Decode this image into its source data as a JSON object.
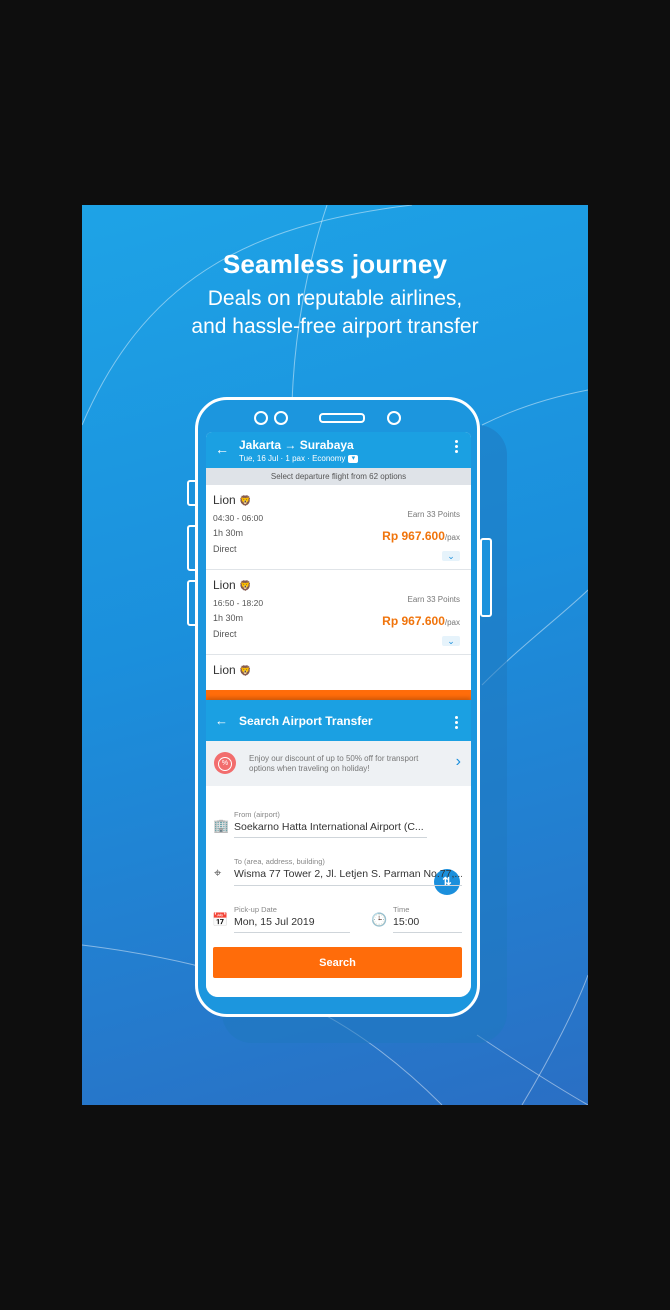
{
  "promo": {
    "headline": "Seamless journey",
    "sub_line_1": "Deals on reputable airlines,",
    "sub_line_2": "and hassle-free airport transfer"
  },
  "flight_screen": {
    "route": "Jakarta → Surabaya",
    "meta": "Tue, 16 Jul · 1 pax · Economy",
    "options_text": "Select departure flight from 62 options",
    "flights": [
      {
        "airline": "Lion",
        "time": "04:30 - 06:00",
        "duration": "1h 30m",
        "stops": "Direct",
        "points": "Earn 33 Points",
        "price": "Rp 967.600",
        "unit": "/pax"
      },
      {
        "airline": "Lion",
        "time": "16:50 - 18:20",
        "duration": "1h 30m",
        "stops": "Direct",
        "points": "Earn 33 Points",
        "price": "Rp 967.600",
        "unit": "/pax"
      },
      {
        "airline": "Lion"
      }
    ]
  },
  "transfer_screen": {
    "title": "Search Airport Transfer",
    "promo_text": "Enjoy our discount of up to 50% off for transport options when traveling on holiday!",
    "from_label": "From (airport)",
    "from_value": "Soekarno Hatta International Airport (C...",
    "to_label": "To (area, address, building)",
    "to_value": "Wisma 77 Tower 2, Jl. Letjen S. Parman No.77,...",
    "date_label": "Pick-up Date",
    "date_value": "Mon, 15 Jul 2019",
    "time_label": "Time",
    "time_value": "15:00",
    "search_label": "Search"
  },
  "colors": {
    "brand_blue": "#1ba0e2",
    "accent_orange": "#ff6c0a",
    "price_orange": "#f0740c"
  },
  "icons": [
    "back-arrow-icon",
    "more-vert-icon",
    "chevron-down-icon",
    "airline-logo-icon",
    "discount-icon",
    "chevron-right-icon",
    "airport-icon",
    "location-pin-icon",
    "swap-icon",
    "calendar-icon",
    "clock-icon"
  ]
}
